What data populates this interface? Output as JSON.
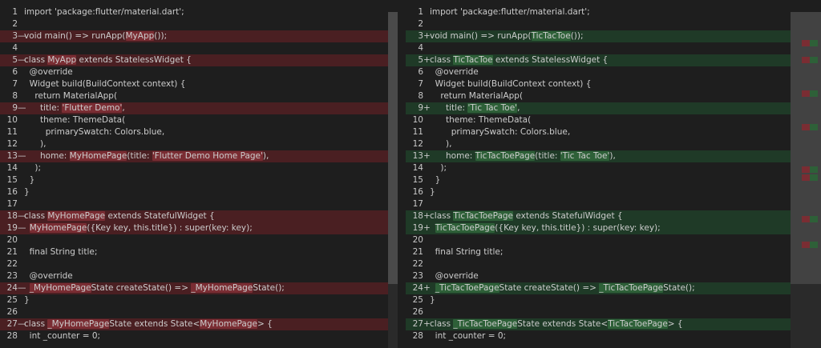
{
  "colors": {
    "removed_line": "#4a1f22",
    "removed_word": "#7a2d33",
    "added_line": "#1f3a27",
    "added_word": "#2e6038",
    "background": "#1e1e1e"
  },
  "left": {
    "lines": [
      {
        "num": "1",
        "marker": "",
        "changed": false,
        "segs": [
          {
            "t": "import 'package:flutter/material.dart';",
            "h": false
          }
        ]
      },
      {
        "num": "2",
        "marker": "",
        "changed": false,
        "segs": []
      },
      {
        "num": "3",
        "marker": "—",
        "changed": true,
        "segs": [
          {
            "t": "void main() => runApp(",
            "h": false
          },
          {
            "t": "MyApp",
            "h": true
          },
          {
            "t": "());",
            "h": false
          }
        ]
      },
      {
        "num": "4",
        "marker": "",
        "changed": false,
        "segs": []
      },
      {
        "num": "5",
        "marker": "—",
        "changed": true,
        "segs": [
          {
            "t": "class ",
            "h": false
          },
          {
            "t": "MyApp",
            "h": true
          },
          {
            "t": " extends StatelessWidget {",
            "h": false
          }
        ]
      },
      {
        "num": "6",
        "marker": "",
        "changed": false,
        "segs": [
          {
            "t": "  @override",
            "h": false
          }
        ]
      },
      {
        "num": "7",
        "marker": "",
        "changed": false,
        "segs": [
          {
            "t": "  Widget build(BuildContext context) {",
            "h": false
          }
        ]
      },
      {
        "num": "8",
        "marker": "",
        "changed": false,
        "segs": [
          {
            "t": "    return MaterialApp(",
            "h": false
          }
        ]
      },
      {
        "num": "9",
        "marker": "—",
        "changed": true,
        "segs": [
          {
            "t": "      title: ",
            "h": false
          },
          {
            "t": "'Flutter Demo'",
            "h": true
          },
          {
            "t": ",",
            "h": false
          }
        ]
      },
      {
        "num": "10",
        "marker": "",
        "changed": false,
        "segs": [
          {
            "t": "      theme: ThemeData(",
            "h": false
          }
        ]
      },
      {
        "num": "11",
        "marker": "",
        "changed": false,
        "segs": [
          {
            "t": "        primarySwatch: Colors.blue,",
            "h": false
          }
        ]
      },
      {
        "num": "12",
        "marker": "",
        "changed": false,
        "segs": [
          {
            "t": "      ),",
            "h": false
          }
        ]
      },
      {
        "num": "13",
        "marker": "—",
        "changed": true,
        "segs": [
          {
            "t": "      home: ",
            "h": false
          },
          {
            "t": "MyHomePage",
            "h": true
          },
          {
            "t": "(title: ",
            "h": false
          },
          {
            "t": "'Flutter Demo Home Page'",
            "h": true
          },
          {
            "t": "),",
            "h": false
          }
        ]
      },
      {
        "num": "14",
        "marker": "",
        "changed": false,
        "segs": [
          {
            "t": "    );",
            "h": false
          }
        ]
      },
      {
        "num": "15",
        "marker": "",
        "changed": false,
        "segs": [
          {
            "t": "  }",
            "h": false
          }
        ]
      },
      {
        "num": "16",
        "marker": "",
        "changed": false,
        "segs": [
          {
            "t": "}",
            "h": false
          }
        ]
      },
      {
        "num": "17",
        "marker": "",
        "changed": false,
        "segs": []
      },
      {
        "num": "18",
        "marker": "—",
        "changed": true,
        "segs": [
          {
            "t": "class ",
            "h": false
          },
          {
            "t": "MyHomePage",
            "h": true
          },
          {
            "t": " extends StatefulWidget {",
            "h": false
          }
        ]
      },
      {
        "num": "19",
        "marker": "—",
        "changed": true,
        "segs": [
          {
            "t": "  ",
            "h": false
          },
          {
            "t": "MyHomePage",
            "h": true
          },
          {
            "t": "({Key key, this.title}) : super(key: key);",
            "h": false
          }
        ]
      },
      {
        "num": "20",
        "marker": "",
        "changed": false,
        "segs": []
      },
      {
        "num": "21",
        "marker": "",
        "changed": false,
        "segs": [
          {
            "t": "  final String title;",
            "h": false
          }
        ]
      },
      {
        "num": "22",
        "marker": "",
        "changed": false,
        "segs": []
      },
      {
        "num": "23",
        "marker": "",
        "changed": false,
        "segs": [
          {
            "t": "  @override",
            "h": false
          }
        ]
      },
      {
        "num": "24",
        "marker": "—",
        "changed": true,
        "segs": [
          {
            "t": "  ",
            "h": false
          },
          {
            "t": "_MyHomePage",
            "h": true
          },
          {
            "t": "State createState() => ",
            "h": false
          },
          {
            "t": "_MyHomePage",
            "h": true
          },
          {
            "t": "State();",
            "h": false
          }
        ]
      },
      {
        "num": "25",
        "marker": "",
        "changed": false,
        "segs": [
          {
            "t": "}",
            "h": false
          }
        ]
      },
      {
        "num": "26",
        "marker": "",
        "changed": false,
        "segs": []
      },
      {
        "num": "27",
        "marker": "—",
        "changed": true,
        "segs": [
          {
            "t": "class ",
            "h": false
          },
          {
            "t": "_MyHomePage",
            "h": true
          },
          {
            "t": "State extends State<",
            "h": false
          },
          {
            "t": "MyHomePage",
            "h": true
          },
          {
            "t": "> {",
            "h": false
          }
        ]
      },
      {
        "num": "28",
        "marker": "",
        "changed": false,
        "segs": [
          {
            "t": "  int _counter = 0;",
            "h": false
          }
        ]
      }
    ]
  },
  "right": {
    "lines": [
      {
        "num": "1",
        "marker": "",
        "changed": false,
        "segs": [
          {
            "t": "import 'package:flutter/material.dart';",
            "h": false
          }
        ]
      },
      {
        "num": "2",
        "marker": "",
        "changed": false,
        "segs": []
      },
      {
        "num": "3",
        "marker": "+",
        "changed": true,
        "segs": [
          {
            "t": "void main() => runApp(",
            "h": false
          },
          {
            "t": "TicTacToe",
            "h": true
          },
          {
            "t": "());",
            "h": false
          }
        ]
      },
      {
        "num": "4",
        "marker": "",
        "changed": false,
        "segs": []
      },
      {
        "num": "5",
        "marker": "+",
        "changed": true,
        "segs": [
          {
            "t": "class ",
            "h": false
          },
          {
            "t": "TicTacToe",
            "h": true
          },
          {
            "t": " extends StatelessWidget {",
            "h": false
          }
        ]
      },
      {
        "num": "6",
        "marker": "",
        "changed": false,
        "segs": [
          {
            "t": "  @override",
            "h": false
          }
        ]
      },
      {
        "num": "7",
        "marker": "",
        "changed": false,
        "segs": [
          {
            "t": "  Widget build(BuildContext context) {",
            "h": false
          }
        ]
      },
      {
        "num": "8",
        "marker": "",
        "changed": false,
        "segs": [
          {
            "t": "    return MaterialApp(",
            "h": false
          }
        ]
      },
      {
        "num": "9",
        "marker": "+",
        "changed": true,
        "segs": [
          {
            "t": "      title: ",
            "h": false
          },
          {
            "t": "'Tic Tac Toe'",
            "h": true
          },
          {
            "t": ",",
            "h": false
          }
        ]
      },
      {
        "num": "10",
        "marker": "",
        "changed": false,
        "segs": [
          {
            "t": "      theme: ThemeData(",
            "h": false
          }
        ]
      },
      {
        "num": "11",
        "marker": "",
        "changed": false,
        "segs": [
          {
            "t": "        primarySwatch: Colors.blue,",
            "h": false
          }
        ]
      },
      {
        "num": "12",
        "marker": "",
        "changed": false,
        "segs": [
          {
            "t": "      ),",
            "h": false
          }
        ]
      },
      {
        "num": "13",
        "marker": "+",
        "changed": true,
        "segs": [
          {
            "t": "      home: ",
            "h": false
          },
          {
            "t": "TicTacToePage",
            "h": true
          },
          {
            "t": "(title: ",
            "h": false
          },
          {
            "t": "'Tic Tac Toe'",
            "h": true
          },
          {
            "t": "),",
            "h": false
          }
        ]
      },
      {
        "num": "14",
        "marker": "",
        "changed": false,
        "segs": [
          {
            "t": "    );",
            "h": false
          }
        ]
      },
      {
        "num": "15",
        "marker": "",
        "changed": false,
        "segs": [
          {
            "t": "  }",
            "h": false
          }
        ]
      },
      {
        "num": "16",
        "marker": "",
        "changed": false,
        "segs": [
          {
            "t": "}",
            "h": false
          }
        ]
      },
      {
        "num": "17",
        "marker": "",
        "changed": false,
        "segs": []
      },
      {
        "num": "18",
        "marker": "+",
        "changed": true,
        "segs": [
          {
            "t": "class ",
            "h": false
          },
          {
            "t": "TicTacToePage",
            "h": true
          },
          {
            "t": " extends StatefulWidget {",
            "h": false
          }
        ]
      },
      {
        "num": "19",
        "marker": "+",
        "changed": true,
        "segs": [
          {
            "t": "  ",
            "h": false
          },
          {
            "t": "TicTacToePage",
            "h": true
          },
          {
            "t": "({Key key, this.title}) : super(key: key);",
            "h": false
          }
        ]
      },
      {
        "num": "20",
        "marker": "",
        "changed": false,
        "segs": []
      },
      {
        "num": "21",
        "marker": "",
        "changed": false,
        "segs": [
          {
            "t": "  final String title;",
            "h": false
          }
        ]
      },
      {
        "num": "22",
        "marker": "",
        "changed": false,
        "segs": []
      },
      {
        "num": "23",
        "marker": "",
        "changed": false,
        "segs": [
          {
            "t": "  @override",
            "h": false
          }
        ]
      },
      {
        "num": "24",
        "marker": "+",
        "changed": true,
        "segs": [
          {
            "t": "  ",
            "h": false
          },
          {
            "t": "_TicTacToePage",
            "h": true
          },
          {
            "t": "State createState() => ",
            "h": false
          },
          {
            "t": "_TicTacToePage",
            "h": true
          },
          {
            "t": "State();",
            "h": false
          }
        ]
      },
      {
        "num": "25",
        "marker": "",
        "changed": false,
        "segs": [
          {
            "t": "}",
            "h": false
          }
        ]
      },
      {
        "num": "26",
        "marker": "",
        "changed": false,
        "segs": []
      },
      {
        "num": "27",
        "marker": "+",
        "changed": true,
        "segs": [
          {
            "t": "class ",
            "h": false
          },
          {
            "t": "_TicTacToePage",
            "h": true
          },
          {
            "t": "State extends State<",
            "h": false
          },
          {
            "t": "TicTacToePage",
            "h": true
          },
          {
            "t": "> {",
            "h": false
          }
        ]
      },
      {
        "num": "28",
        "marker": "",
        "changed": false,
        "segs": [
          {
            "t": "  int _counter = 0;",
            "h": false
          }
        ]
      }
    ]
  }
}
